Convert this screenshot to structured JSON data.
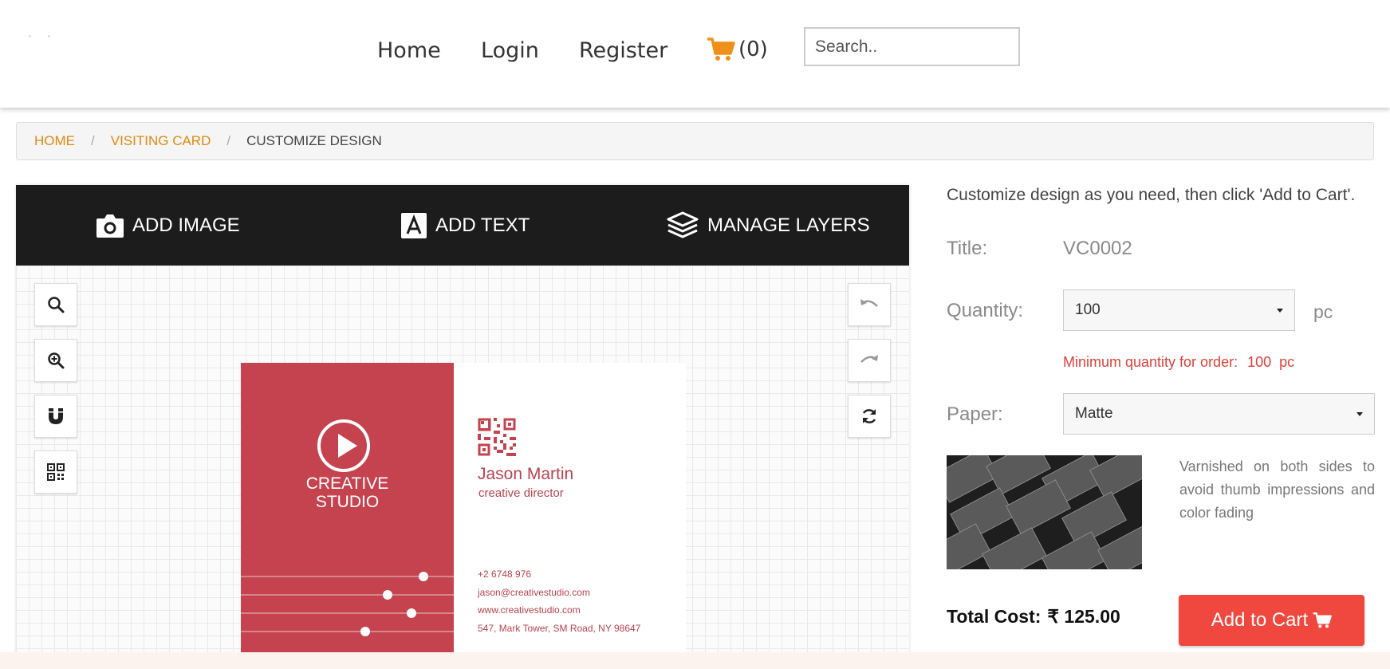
{
  "header": {
    "nav": [
      {
        "label": "Home"
      },
      {
        "label": "Login"
      },
      {
        "label": "Register"
      }
    ],
    "cart_count": "(0)",
    "search_placeholder": "Search.."
  },
  "breadcrumb": {
    "home": "HOME",
    "category": "VISITING CARD",
    "current": "CUSTOMIZE DESIGN",
    "separator": "/"
  },
  "toolbar": {
    "add_image": "ADD IMAGE",
    "add_text": "ADD TEXT",
    "manage_layers": "MANAGE LAYERS"
  },
  "card": {
    "studio_line1": "CREATIVE",
    "studio_line2": "STUDIO",
    "name": "Jason Martin",
    "role": "creative director",
    "phone": "+2 6748 976",
    "email": "jason@creativestudio.com",
    "website": "www.creativestudio.com",
    "address": "547, Mark Tower, SM Road, NY 98647"
  },
  "panel": {
    "intro": "Customize design as you need, then click 'Add to Cart'.",
    "title_label": "Title:",
    "title_value": "VC0002",
    "quantity_label": "Quantity:",
    "quantity_value": "100",
    "quantity_unit": "pc",
    "min_label": "Minimum quantity for order:",
    "min_value": "100  pc",
    "paper_label": "Paper:",
    "paper_value": "Matte",
    "paper_desc": "Varnished on both sides to avoid thumb impressions and color fading",
    "total_label": "Total Cost:",
    "total_value": "₹ 125.00",
    "add_to_cart": "Add to Cart"
  },
  "colors": {
    "accent": "#e08a0f",
    "card_red": "#c4434f",
    "button_red": "#f0483e",
    "toolbar_dark": "#1c1c1c"
  }
}
